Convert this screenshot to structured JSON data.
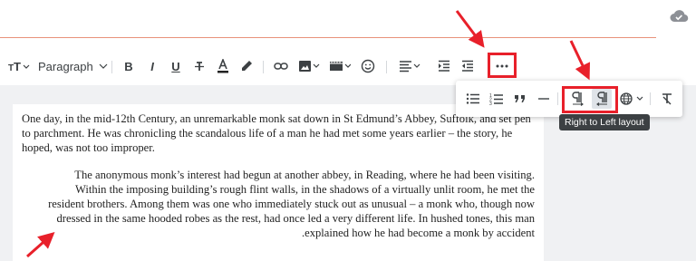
{
  "toolbar": {
    "block_format": "Paragraph",
    "icons": [
      "font-size-icon",
      "bold-icon",
      "italic-icon",
      "underline-icon",
      "strikethrough-icon",
      "text-color-icon",
      "highlight-icon",
      "link-icon",
      "image-icon",
      "media-icon",
      "emoji-icon",
      "align-icon",
      "indent-icon",
      "outdent-icon",
      "more-icon"
    ]
  },
  "popup": {
    "icons": [
      "bullet-list-icon",
      "numbered-list-icon",
      "blockquote-icon",
      "horizontal-rule-icon",
      "ltr-icon",
      "rtl-icon",
      "language-icon",
      "clear-format-icon"
    ]
  },
  "tooltip": "Right to Left layout",
  "editor": {
    "para1": "One day, in the mid-12th Century, an unremarkable monk sat down in St Edmund’s Abbey, Suffolk, and set pen to parchment. He was chronicling the scandalous life of a man he had met some years earlier – the story, he hoped, was not too improper.",
    "para2_lines": [
      "The anonymous monk’s interest had begun at another abbey, in Reading, where he had been visiting.",
      "Within the imposing building’s rough flint walls, in the shadows of a virtually unlit room, he met the",
      "resident brothers. Among them was one who immediately stuck out as unusual – a monk who, though now",
      "dressed in the same hooded robes as the rest, had once led a very different life. In hushed tones, this man",
      ".explained how he had become a monk by accident"
    ]
  },
  "colors": {
    "accent_line": "#e8927a",
    "annotation": "#e8202a",
    "active_button": "#dfe3e8"
  }
}
